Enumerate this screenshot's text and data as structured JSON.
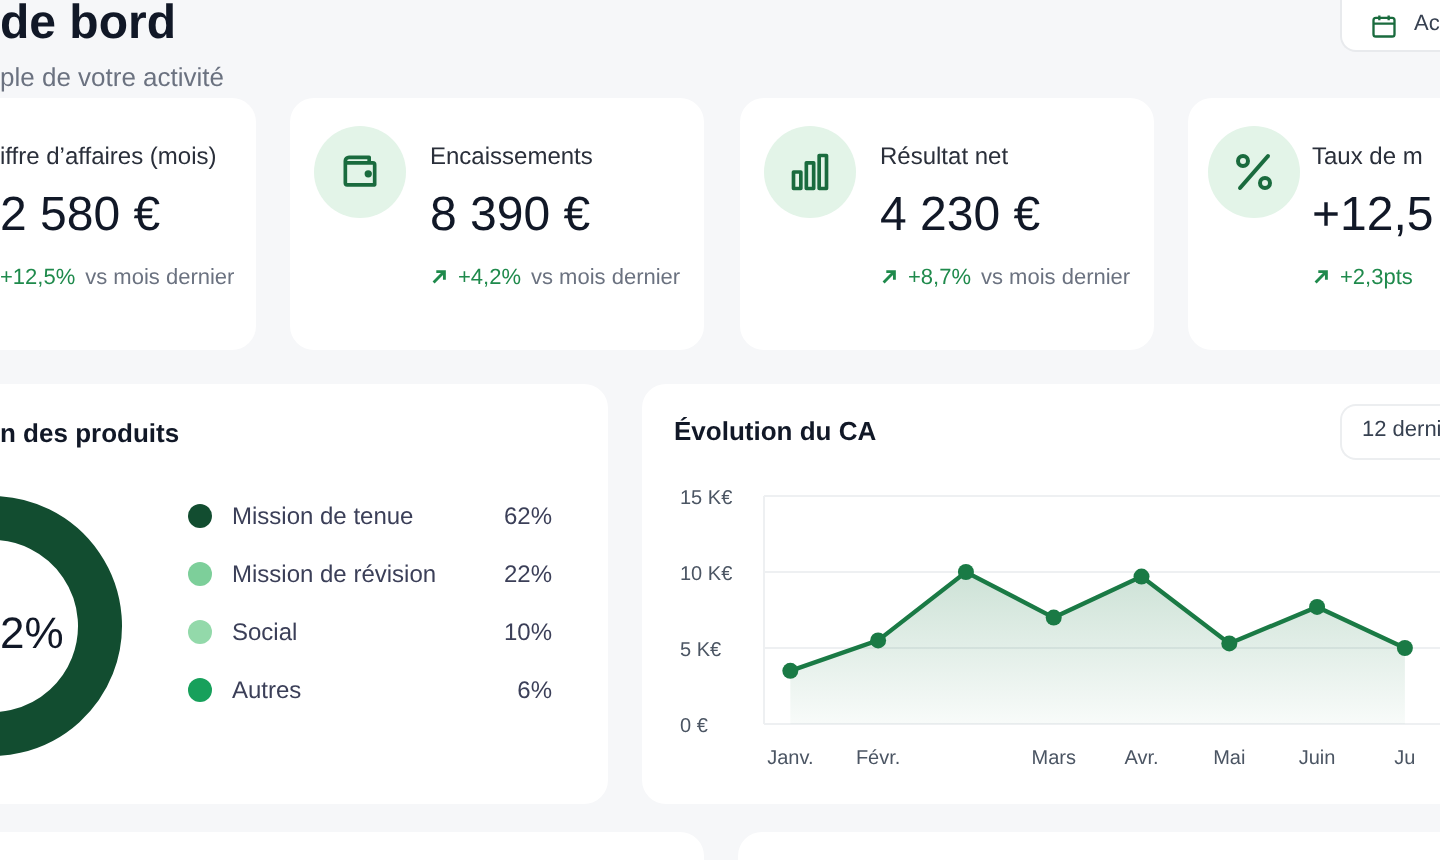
{
  "header": {
    "title": "de bord",
    "subtitle": "ple de votre activité",
    "date_button": "Ac"
  },
  "kpis": [
    {
      "label": "iffre d’affaires (mois)",
      "value": "2 580 €",
      "change": "+12,5%",
      "note": "vs mois dernier"
    },
    {
      "kind": "wallet",
      "label": "Encaissements",
      "value": "8 390 €",
      "change": "+4,2%",
      "note": "vs mois dernier"
    },
    {
      "kind": "bars",
      "label": "Résultat net",
      "value": "4 230 €",
      "change": "+8,7%",
      "note": "vs mois dernier"
    },
    {
      "kind": "percent",
      "label": "Taux de m",
      "value": "+12,5",
      "change": "+2,3pts"
    }
  ],
  "breakdown": {
    "title": "n des produits",
    "center": "2%",
    "items": [
      {
        "label": "Mission de tenue",
        "share": "62%",
        "color": "#124d30"
      },
      {
        "label": "Mission de révision",
        "share": "22%",
        "color": "#7dcf9a"
      },
      {
        "label": "Social",
        "share": "10%",
        "color": "#93d9aa"
      },
      {
        "label": "Autres",
        "share": "6%",
        "color": "#17a05b"
      }
    ]
  },
  "revenue": {
    "title": "Évolution du CA",
    "period_button": "12 derni",
    "chart_data": {
      "type": "area",
      "categories": [
        "Janv.",
        "Févr.",
        null,
        "Mars",
        "Avr.",
        "Mai",
        "Juin",
        "Ju"
      ],
      "series": [
        {
          "color": "#1a7a45",
          "values": [
            3.5,
            5.5,
            10,
            7,
            9.7,
            5.3,
            7.7,
            5.0
          ]
        }
      ],
      "ylim": [
        0,
        15
      ],
      "yticks": [
        {
          "value": 0,
          "label": "0 €"
        },
        {
          "value": 5,
          "label": "5 K€"
        },
        {
          "value": 10,
          "label": "10 K€"
        },
        {
          "value": 15,
          "label": "15 K€"
        }
      ]
    }
  }
}
